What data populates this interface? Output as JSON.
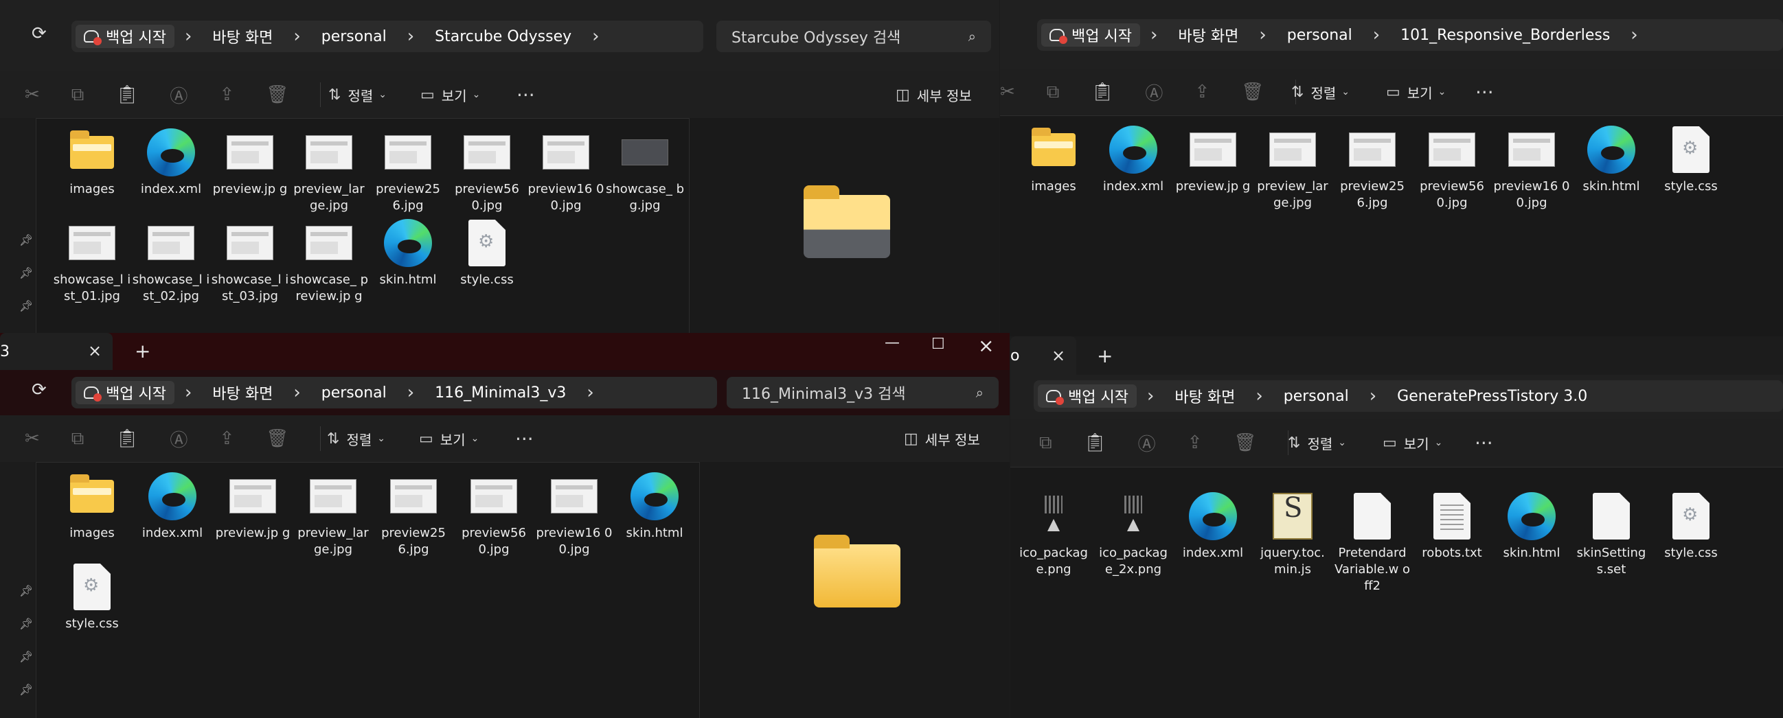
{
  "common": {
    "start_label": "백업 시작",
    "desktop_label": "바탕 화면",
    "personal_label": "personal",
    "sort_label": "정렬",
    "view_label": "보기",
    "details_label": "세부 정보"
  },
  "w1": {
    "folder": "Starcube Odyssey",
    "search_placeholder": "Starcube Odyssey 검색",
    "files": [
      {
        "name": "images",
        "type": "folder"
      },
      {
        "name": "index.xml",
        "type": "edge"
      },
      {
        "name": "preview.jp g",
        "type": "thumb"
      },
      {
        "name": "preview_lar ge.jpg",
        "type": "thumb"
      },
      {
        "name": "preview25 6.jpg",
        "type": "thumb"
      },
      {
        "name": "preview56 0.jpg",
        "type": "thumb"
      },
      {
        "name": "preview16 00.jpg",
        "type": "thumb"
      },
      {
        "name": "showcase_ bg.jpg",
        "type": "dark"
      },
      {
        "name": "showcase_l ist_01.jpg",
        "type": "thumb"
      },
      {
        "name": "showcase_l ist_02.jpg",
        "type": "thumb"
      },
      {
        "name": "showcase_l ist_03.jpg",
        "type": "thumb"
      },
      {
        "name": "showcase_ preview.jp g",
        "type": "thumb"
      },
      {
        "name": "skin.html",
        "type": "edge"
      },
      {
        "name": "style.css",
        "type": "css"
      }
    ]
  },
  "w2": {
    "folder": "101_Responsive_Borderless",
    "files": [
      {
        "name": "images",
        "type": "folder"
      },
      {
        "name": "index.xml",
        "type": "edge"
      },
      {
        "name": "preview.jp g",
        "type": "thumb"
      },
      {
        "name": "preview_lar ge.jpg",
        "type": "thumb"
      },
      {
        "name": "preview25 6.jpg",
        "type": "thumb"
      },
      {
        "name": "preview56 0.jpg",
        "type": "thumb"
      },
      {
        "name": "preview16 00.jpg",
        "type": "thumb"
      },
      {
        "name": "skin.html",
        "type": "edge"
      },
      {
        "name": "style.css",
        "type": "css"
      }
    ]
  },
  "w3": {
    "tab_title": "3",
    "folder": "116_Minimal3_v3",
    "search_placeholder": "116_Minimal3_v3 검색",
    "files": [
      {
        "name": "images",
        "type": "folder"
      },
      {
        "name": "index.xml",
        "type": "edge"
      },
      {
        "name": "preview.jp g",
        "type": "thumb"
      },
      {
        "name": "preview_lar ge.jpg",
        "type": "thumb"
      },
      {
        "name": "preview25 6.jpg",
        "type": "thumb"
      },
      {
        "name": "preview56 0.jpg",
        "type": "thumb"
      },
      {
        "name": "preview16 00.jpg",
        "type": "thumb"
      },
      {
        "name": "skin.html",
        "type": "edge"
      },
      {
        "name": "style.css",
        "type": "css"
      }
    ]
  },
  "w4": {
    "tab_title": "o",
    "folder": "GeneratePressTistory 3.0",
    "files": [
      {
        "name": "ico_packag e.png",
        "type": "pkg"
      },
      {
        "name": "ico_packag e_2x.png",
        "type": "pkg"
      },
      {
        "name": "index.xml",
        "type": "edge"
      },
      {
        "name": "jquery.toc. min.js",
        "type": "js"
      },
      {
        "name": "Pretendard Variable.w off2",
        "type": "doc"
      },
      {
        "name": "robots.txt",
        "type": "txt"
      },
      {
        "name": "skin.html",
        "type": "edge"
      },
      {
        "name": "skinSetting s.set",
        "type": "doc"
      },
      {
        "name": "style.css",
        "type": "css"
      }
    ]
  }
}
